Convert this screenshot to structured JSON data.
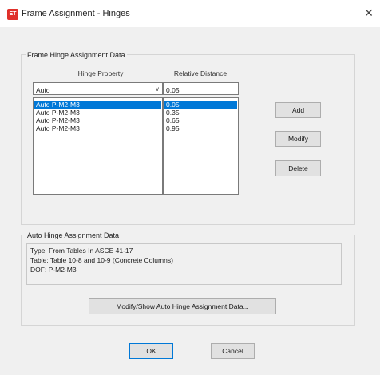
{
  "window": {
    "title": "Frame Assignment - Hinges",
    "icon_text": "ET",
    "close": "✕"
  },
  "hinge_group": {
    "label": "Frame Hinge Assignment Data",
    "hinge_property_header": "Hinge Property",
    "relative_distance_header": "Relative Distance",
    "hinge_property_value": "Auto",
    "relative_distance_value": "0.05",
    "rows": [
      {
        "property": "Auto P-M2-M3",
        "distance": "0.05",
        "selected": true
      },
      {
        "property": "Auto P-M2-M3",
        "distance": "0.35",
        "selected": false
      },
      {
        "property": "Auto P-M2-M3",
        "distance": "0.65",
        "selected": false
      },
      {
        "property": "Auto P-M2-M3",
        "distance": "0.95",
        "selected": false
      }
    ],
    "add_label": "Add",
    "modify_label": "Modify",
    "delete_label": "Delete"
  },
  "auto_group": {
    "label": "Auto Hinge Assignment Data",
    "lines": [
      "Type:  From Tables In ASCE 41-17",
      "Table:  Table 10-8 and 10-9 (Concrete Columns)",
      "DOF:  P-M2-M3"
    ],
    "modify_show_label": "Modify/Show Auto Hinge Assignment Data..."
  },
  "footer": {
    "ok_label": "OK",
    "cancel_label": "Cancel"
  },
  "colors": {
    "selection": "#0078d7",
    "icon": "#e0302a"
  }
}
